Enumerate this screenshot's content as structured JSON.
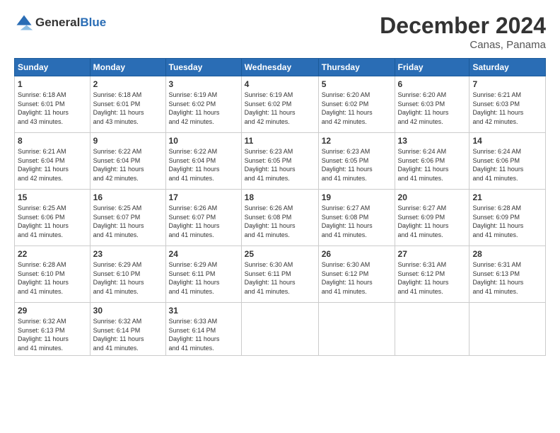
{
  "header": {
    "logo_general": "General",
    "logo_blue": "Blue",
    "title": "December 2024",
    "location": "Canas, Panama"
  },
  "columns": [
    "Sunday",
    "Monday",
    "Tuesday",
    "Wednesday",
    "Thursday",
    "Friday",
    "Saturday"
  ],
  "weeks": [
    [
      {
        "day": "1",
        "info": "Sunrise: 6:18 AM\nSunset: 6:01 PM\nDaylight: 11 hours\nand 43 minutes."
      },
      {
        "day": "2",
        "info": "Sunrise: 6:18 AM\nSunset: 6:01 PM\nDaylight: 11 hours\nand 43 minutes."
      },
      {
        "day": "3",
        "info": "Sunrise: 6:19 AM\nSunset: 6:02 PM\nDaylight: 11 hours\nand 42 minutes."
      },
      {
        "day": "4",
        "info": "Sunrise: 6:19 AM\nSunset: 6:02 PM\nDaylight: 11 hours\nand 42 minutes."
      },
      {
        "day": "5",
        "info": "Sunrise: 6:20 AM\nSunset: 6:02 PM\nDaylight: 11 hours\nand 42 minutes."
      },
      {
        "day": "6",
        "info": "Sunrise: 6:20 AM\nSunset: 6:03 PM\nDaylight: 11 hours\nand 42 minutes."
      },
      {
        "day": "7",
        "info": "Sunrise: 6:21 AM\nSunset: 6:03 PM\nDaylight: 11 hours\nand 42 minutes."
      }
    ],
    [
      {
        "day": "8",
        "info": "Sunrise: 6:21 AM\nSunset: 6:04 PM\nDaylight: 11 hours\nand 42 minutes."
      },
      {
        "day": "9",
        "info": "Sunrise: 6:22 AM\nSunset: 6:04 PM\nDaylight: 11 hours\nand 42 minutes."
      },
      {
        "day": "10",
        "info": "Sunrise: 6:22 AM\nSunset: 6:04 PM\nDaylight: 11 hours\nand 41 minutes."
      },
      {
        "day": "11",
        "info": "Sunrise: 6:23 AM\nSunset: 6:05 PM\nDaylight: 11 hours\nand 41 minutes."
      },
      {
        "day": "12",
        "info": "Sunrise: 6:23 AM\nSunset: 6:05 PM\nDaylight: 11 hours\nand 41 minutes."
      },
      {
        "day": "13",
        "info": "Sunrise: 6:24 AM\nSunset: 6:06 PM\nDaylight: 11 hours\nand 41 minutes."
      },
      {
        "day": "14",
        "info": "Sunrise: 6:24 AM\nSunset: 6:06 PM\nDaylight: 11 hours\nand 41 minutes."
      }
    ],
    [
      {
        "day": "15",
        "info": "Sunrise: 6:25 AM\nSunset: 6:06 PM\nDaylight: 11 hours\nand 41 minutes."
      },
      {
        "day": "16",
        "info": "Sunrise: 6:25 AM\nSunset: 6:07 PM\nDaylight: 11 hours\nand 41 minutes."
      },
      {
        "day": "17",
        "info": "Sunrise: 6:26 AM\nSunset: 6:07 PM\nDaylight: 11 hours\nand 41 minutes."
      },
      {
        "day": "18",
        "info": "Sunrise: 6:26 AM\nSunset: 6:08 PM\nDaylight: 11 hours\nand 41 minutes."
      },
      {
        "day": "19",
        "info": "Sunrise: 6:27 AM\nSunset: 6:08 PM\nDaylight: 11 hours\nand 41 minutes."
      },
      {
        "day": "20",
        "info": "Sunrise: 6:27 AM\nSunset: 6:09 PM\nDaylight: 11 hours\nand 41 minutes."
      },
      {
        "day": "21",
        "info": "Sunrise: 6:28 AM\nSunset: 6:09 PM\nDaylight: 11 hours\nand 41 minutes."
      }
    ],
    [
      {
        "day": "22",
        "info": "Sunrise: 6:28 AM\nSunset: 6:10 PM\nDaylight: 11 hours\nand 41 minutes."
      },
      {
        "day": "23",
        "info": "Sunrise: 6:29 AM\nSunset: 6:10 PM\nDaylight: 11 hours\nand 41 minutes."
      },
      {
        "day": "24",
        "info": "Sunrise: 6:29 AM\nSunset: 6:11 PM\nDaylight: 11 hours\nand 41 minutes."
      },
      {
        "day": "25",
        "info": "Sunrise: 6:30 AM\nSunset: 6:11 PM\nDaylight: 11 hours\nand 41 minutes."
      },
      {
        "day": "26",
        "info": "Sunrise: 6:30 AM\nSunset: 6:12 PM\nDaylight: 11 hours\nand 41 minutes."
      },
      {
        "day": "27",
        "info": "Sunrise: 6:31 AM\nSunset: 6:12 PM\nDaylight: 11 hours\nand 41 minutes."
      },
      {
        "day": "28",
        "info": "Sunrise: 6:31 AM\nSunset: 6:13 PM\nDaylight: 11 hours\nand 41 minutes."
      }
    ],
    [
      {
        "day": "29",
        "info": "Sunrise: 6:32 AM\nSunset: 6:13 PM\nDaylight: 11 hours\nand 41 minutes."
      },
      {
        "day": "30",
        "info": "Sunrise: 6:32 AM\nSunset: 6:14 PM\nDaylight: 11 hours\nand 41 minutes."
      },
      {
        "day": "31",
        "info": "Sunrise: 6:33 AM\nSunset: 6:14 PM\nDaylight: 11 hours\nand 41 minutes."
      },
      {
        "day": "",
        "info": ""
      },
      {
        "day": "",
        "info": ""
      },
      {
        "day": "",
        "info": ""
      },
      {
        "day": "",
        "info": ""
      }
    ]
  ]
}
